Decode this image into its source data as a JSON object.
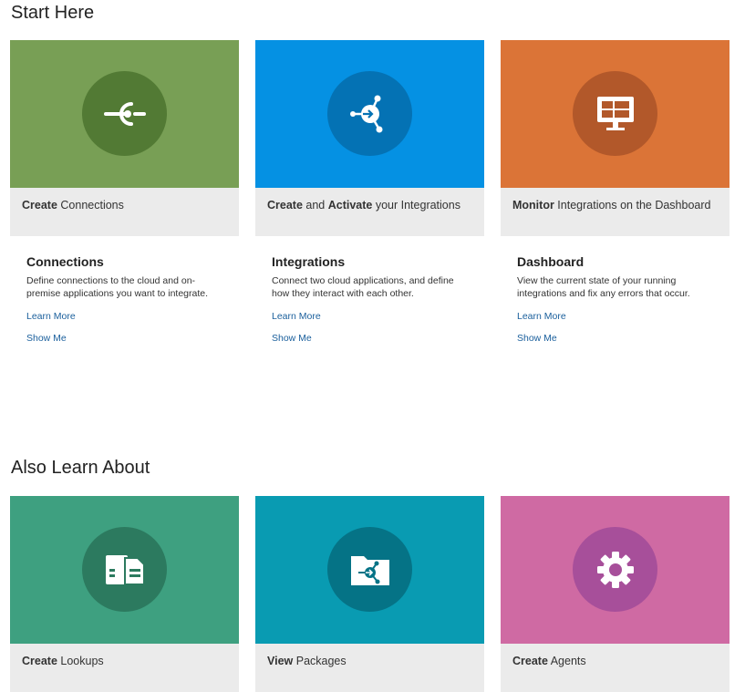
{
  "start_here": {
    "title": "Start Here",
    "cards": [
      {
        "tile_color": "#789f55",
        "circle_color": "#527a34",
        "icon": "connection-icon",
        "caption_bold": "Create",
        "caption_rest": " Connections",
        "heading": "Connections",
        "description": "Define connections to the cloud and on-premise applications you want to integrate.",
        "learn_more": "Learn More",
        "show_me": "Show Me"
      },
      {
        "tile_color": "#0591e3",
        "circle_color": "#0472b4",
        "icon": "integration-icon",
        "caption_bold": "Create",
        "caption_mid": " and ",
        "caption_bold2": "Activate",
        "caption_rest": " your Integrations",
        "heading": "Integrations",
        "description": "Connect two cloud applications, and define how they interact with each other.",
        "learn_more": "Learn More",
        "show_me": "Show Me"
      },
      {
        "tile_color": "#db7437",
        "circle_color": "#b2582a",
        "icon": "dashboard-monitor-icon",
        "caption_bold": "Monitor",
        "caption_rest": " Integrations on the Dashboard",
        "heading": "Dashboard",
        "description": "View the current state of your running integrations and fix any errors that occur.",
        "learn_more": "Learn More",
        "show_me": "Show Me"
      }
    ]
  },
  "also_learn": {
    "title": "Also Learn About",
    "cards": [
      {
        "tile_color": "#3ea080",
        "circle_color": "#2c7a5f",
        "icon": "lookup-document-icon",
        "caption_bold": "Create",
        "caption_rest": " Lookups"
      },
      {
        "tile_color": "#099bb2",
        "circle_color": "#057386",
        "icon": "package-folder-icon",
        "caption_bold": "View",
        "caption_rest": " Packages"
      },
      {
        "tile_color": "#cf6aa3",
        "circle_color": "#a74f9a",
        "icon": "gear-icon",
        "caption_bold": "Create",
        "caption_rest": " Agents"
      }
    ]
  }
}
